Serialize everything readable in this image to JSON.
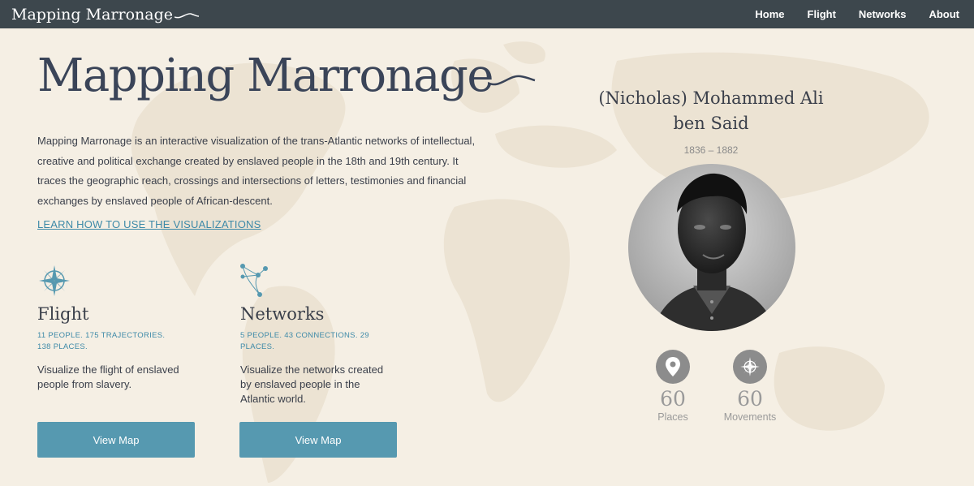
{
  "nav": {
    "brand": "Mapping Marronage",
    "links": [
      "Home",
      "Flight",
      "Networks",
      "About"
    ]
  },
  "hero": {
    "title": "Mapping Marronage",
    "intro": "Mapping Marronage is an interactive visualization of the trans-Atlantic networks of intellectual, creative and political exchange created by enslaved people in the 18th and 19th century. It traces the geographic reach, crossings and intersections of letters, testimonies and financial exchanges by enslaved people of African-descent.",
    "learn_link": "LEARN HOW TO USE THE VISUALIZATIONS"
  },
  "cards": [
    {
      "title": "Flight",
      "icon": "compass-rose-icon",
      "stats": "11 PEOPLE. 175 TRAJECTORIES. 138 PLACES.",
      "description": "Visualize the flight of enslaved people from slavery.",
      "button": "View Map"
    },
    {
      "title": "Networks",
      "icon": "network-nodes-icon",
      "stats": "5 PEOPLE. 43 CONNECTIONS. 29 PLACES.",
      "description": "Visualize the networks created by enslaved people in the Atlantic world.",
      "button": "View Map"
    }
  ],
  "person": {
    "name": "(Nicholas) Mohammed Ali ben Said",
    "years": "1836 – 1882",
    "portrait_icon": "portrait-photo",
    "stats": [
      {
        "icon": "map-pin-icon",
        "value": "60",
        "label": "Places"
      },
      {
        "icon": "compass-rose-icon",
        "value": "60",
        "label": "Movements"
      }
    ]
  },
  "colors": {
    "navbar": "#3d474d",
    "background": "#f5efe4",
    "accent": "#5699b0",
    "link": "#3e8aa8",
    "muted": "#9a9a9a"
  }
}
